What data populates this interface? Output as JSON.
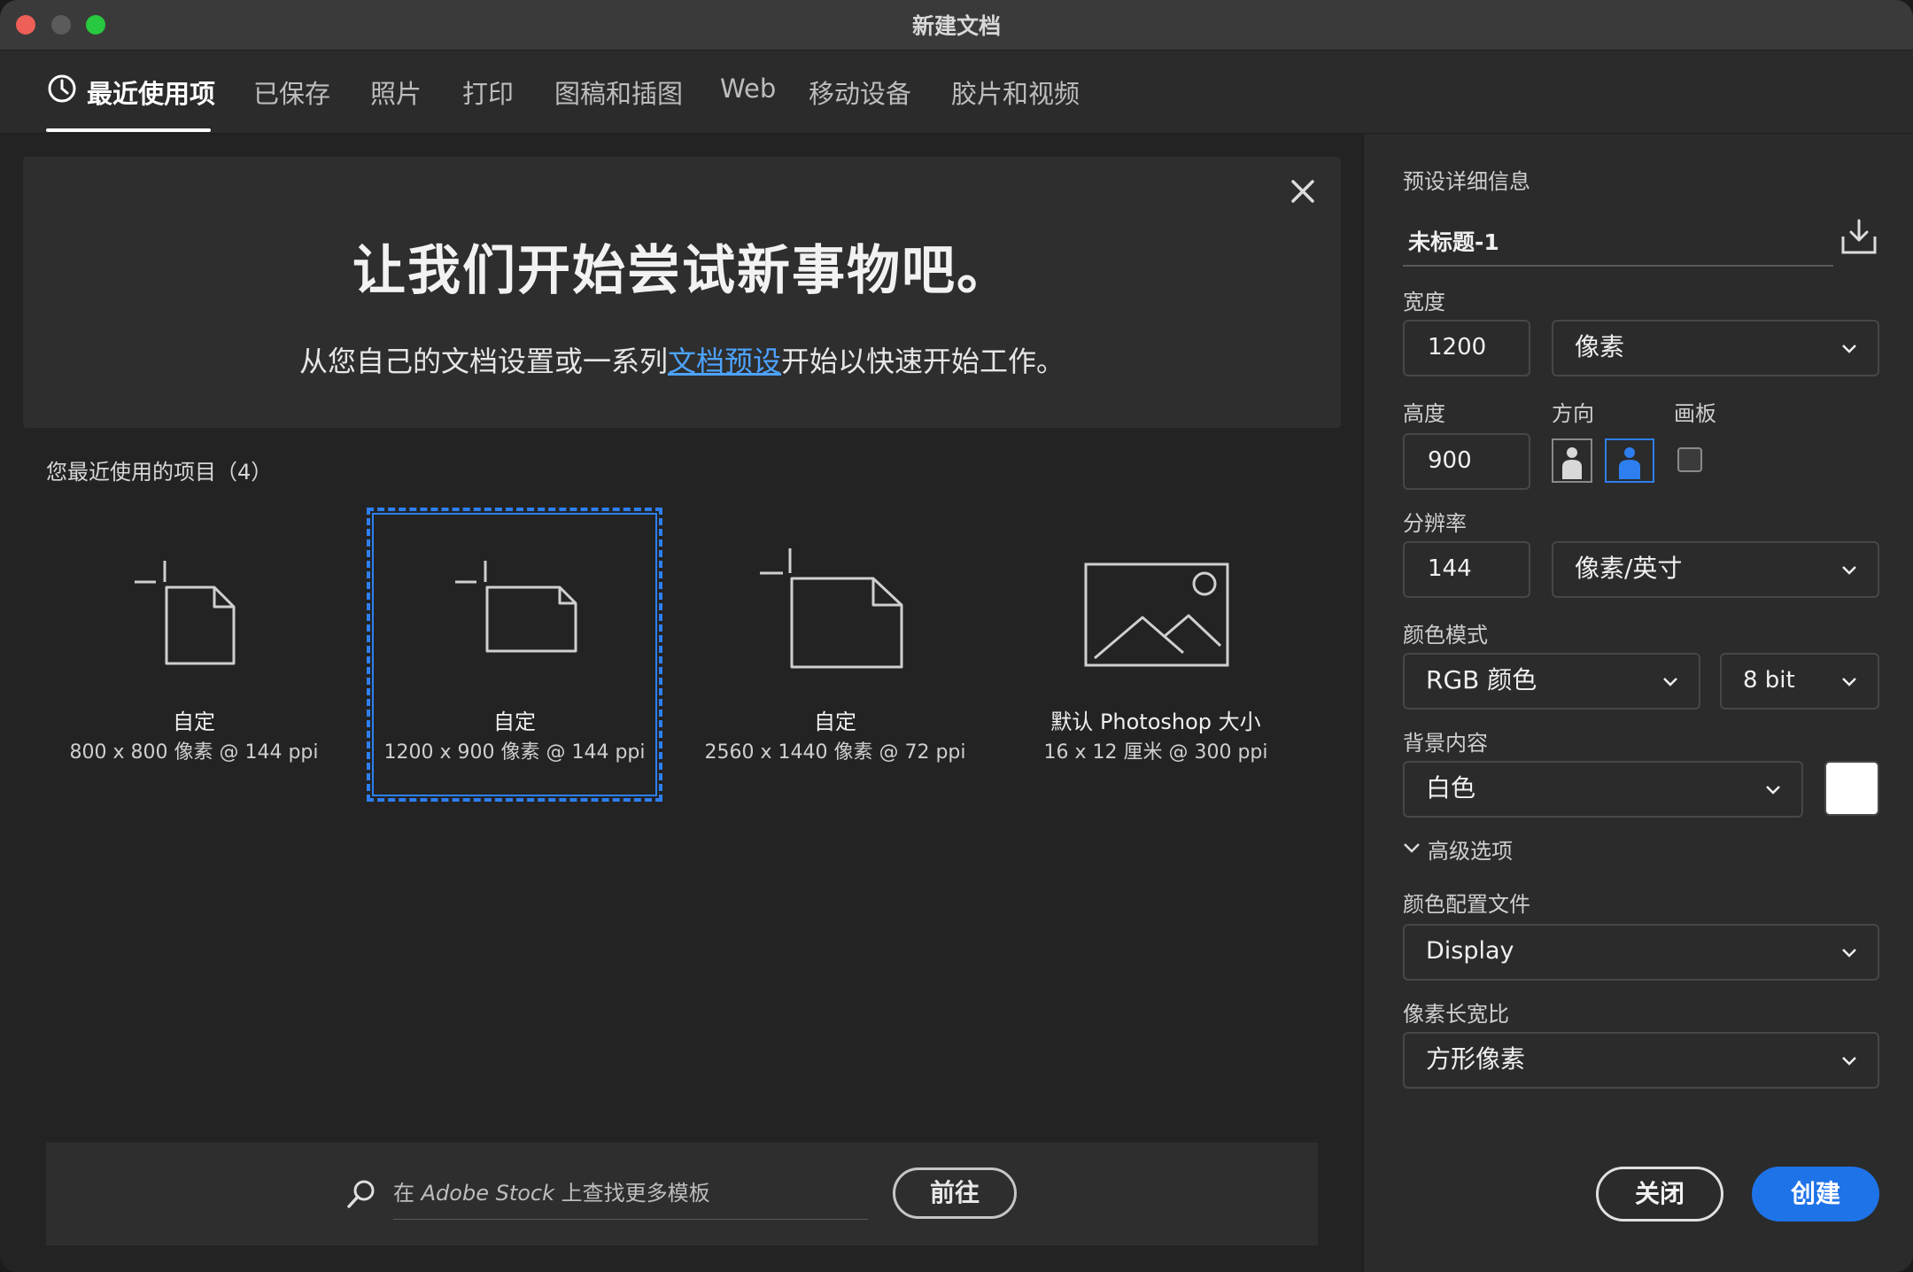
{
  "window": {
    "title": "新建文档"
  },
  "tabs": [
    {
      "label": "最近使用项"
    },
    {
      "label": "已保存"
    },
    {
      "label": "照片"
    },
    {
      "label": "打印"
    },
    {
      "label": "图稿和插图"
    },
    {
      "label": "Web"
    },
    {
      "label": "移动设备"
    },
    {
      "label": "胶片和视频"
    }
  ],
  "banner": {
    "title": "让我们开始尝试新事物吧。",
    "sub_prefix": "从您自己的文档设置或一系列",
    "sub_link": "文档预设",
    "sub_suffix": "开始以快速开始工作。"
  },
  "recent": {
    "heading": "您最近使用的项目（4）",
    "items": [
      {
        "name": "自定",
        "desc": "800 x 800 像素 @ 144 ppi"
      },
      {
        "name": "自定",
        "desc": "1200 x 900 像素 @ 144 ppi"
      },
      {
        "name": "自定",
        "desc": "2560 x 1440 像素 @ 72 ppi"
      },
      {
        "name": "默认 Photoshop 大小",
        "desc": "16 x 12 厘米 @ 300 ppi"
      }
    ]
  },
  "stock": {
    "prefix": "在 ",
    "brand": "Adobe Stock",
    "suffix": " 上查找更多模板",
    "go_label": "前往"
  },
  "preset": {
    "heading": "预设详细信息",
    "name": "未标题-1",
    "width_label": "宽度",
    "width_value": "1200",
    "width_unit": "像素",
    "height_label": "高度",
    "height_value": "900",
    "orientation_label": "方向",
    "artboard_label": "画板",
    "resolution_label": "分辨率",
    "resolution_value": "144",
    "resolution_unit": "像素/英寸",
    "color_mode_label": "颜色模式",
    "color_mode": "RGB 颜色",
    "bit_depth": "8 bit",
    "background_label": "背景内容",
    "background": "白色",
    "background_color": "#ffffff",
    "advanced_label": "高级选项",
    "profile_label": "颜色配置文件",
    "profile": "Display",
    "aspect_label": "像素长宽比",
    "aspect": "方形像素",
    "close_label": "关闭",
    "create_label": "创建"
  },
  "colors": {
    "accent": "#2d7ff0",
    "create_button": "#1e73e8",
    "link": "#4da3ff"
  }
}
